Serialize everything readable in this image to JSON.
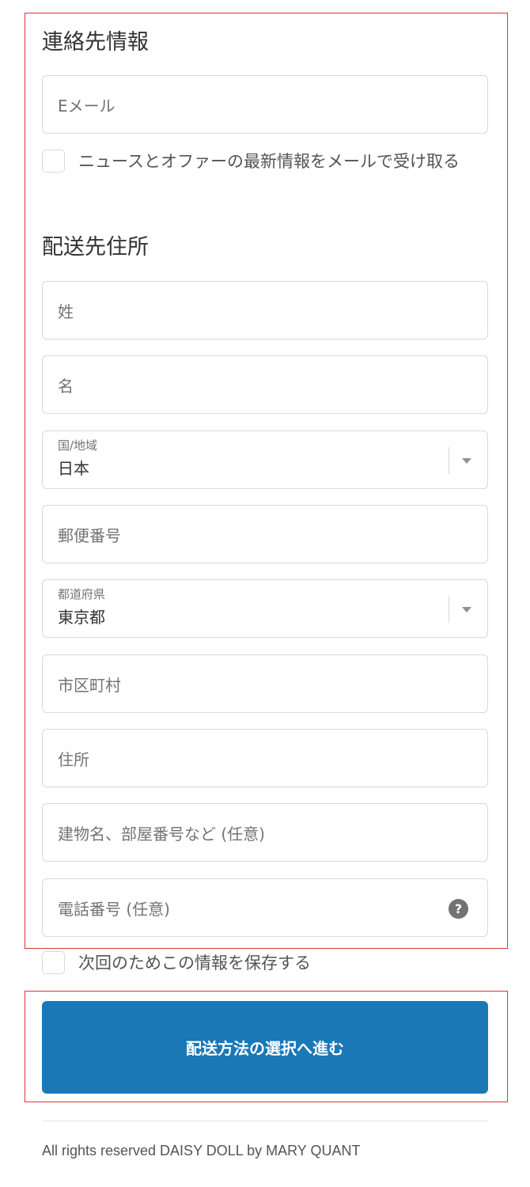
{
  "contact": {
    "heading": "連絡先情報",
    "email_placeholder": "Eメール",
    "newsletter_label": "ニュースとオファーの最新情報をメールで受け取る"
  },
  "shipping": {
    "heading": "配送先住所",
    "last_name_placeholder": "姓",
    "first_name_placeholder": "名",
    "country_label": "国/地域",
    "country_value": "日本",
    "postal_placeholder": "郵便番号",
    "prefecture_label": "都道府県",
    "prefecture_value": "東京都",
    "city_placeholder": "市区町村",
    "address_placeholder": "住所",
    "building_placeholder": "建物名、部屋番号など (任意)",
    "phone_placeholder": "電話番号 (任意)",
    "phone_help_icon": "?"
  },
  "save_info_label": "次回のためこの情報を保存する",
  "submit_label": "配送方法の選択へ進む",
  "footer_text": "All rights reserved DAISY DOLL by MARY QUANT",
  "colors": {
    "primary_button": "#1a78b7",
    "highlight_border": "#d9363e"
  },
  "icons": {
    "help": "question-circle-icon",
    "select": "chevron-down-icon"
  }
}
